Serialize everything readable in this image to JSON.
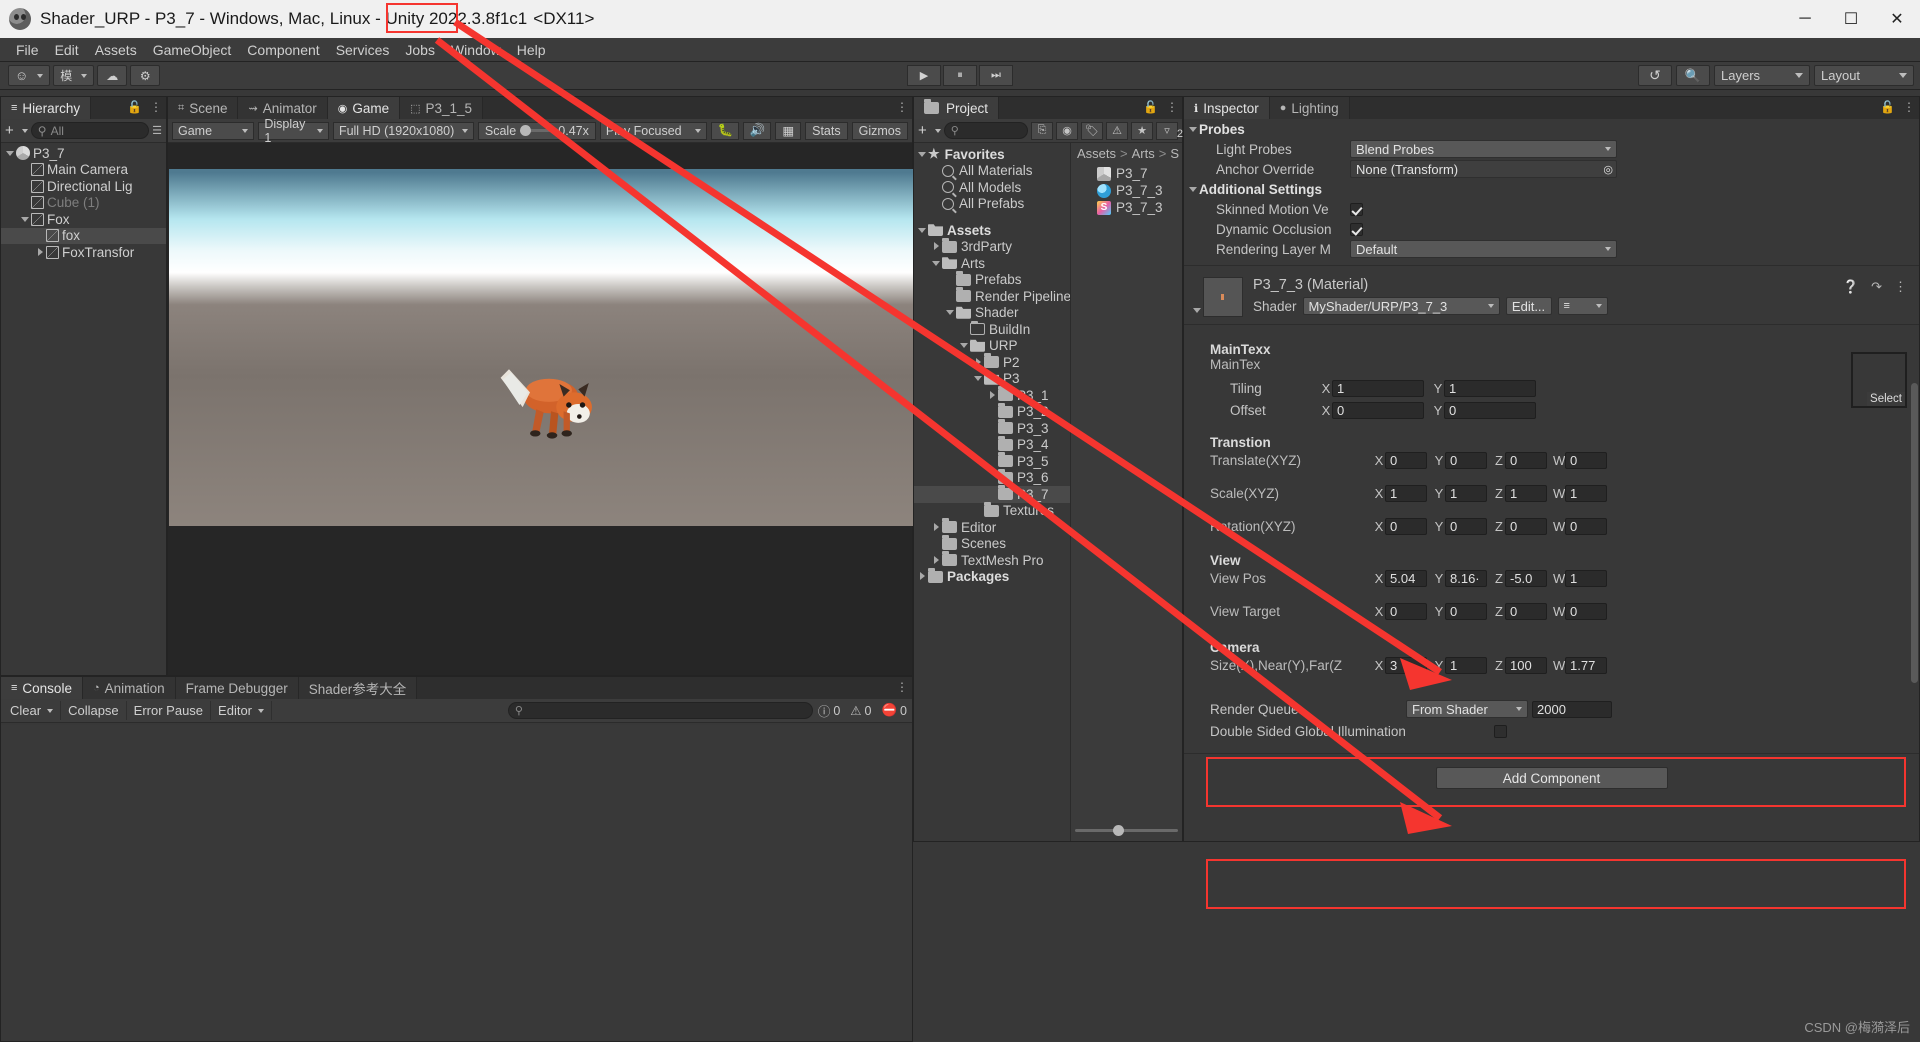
{
  "window": {
    "title": "Shader_URP - P3_7 - Windows, Mac, Linux - Unity 2022.3.8f1c1",
    "graphics_api": "<DX11>",
    "minimize": "─",
    "maximize": "☐",
    "close": "✕"
  },
  "menu": [
    "File",
    "Edit",
    "Assets",
    "GameObject",
    "Component",
    "Services",
    "Jobs",
    "Window",
    "Help"
  ],
  "toolbar": {
    "account_label": "☺",
    "cloud_label": "☁",
    "settings_label": "⚙",
    "collab_label": "模",
    "play": "▶",
    "pause": "⏸",
    "step": "⏭",
    "undo_history": "↺",
    "search": "search-icon",
    "layers": "Layers",
    "layout": "Layout"
  },
  "hierarchy": {
    "tab": "Hierarchy",
    "add_label": "+",
    "search_placeholder": "All",
    "items": [
      {
        "label": "P3_7",
        "indent": 0,
        "icon": "unity",
        "expand": "down",
        "dim": false,
        "selected": false
      },
      {
        "label": "Main Camera",
        "indent": 1,
        "icon": "cube",
        "expand": "none",
        "dim": false,
        "selected": false
      },
      {
        "label": "Directional Lig",
        "indent": 1,
        "icon": "cube",
        "expand": "none",
        "dim": false,
        "selected": false
      },
      {
        "label": "Cube (1)",
        "indent": 1,
        "icon": "cube",
        "expand": "none",
        "dim": true,
        "selected": false
      },
      {
        "label": "Fox",
        "indent": 1,
        "icon": "cube",
        "expand": "down",
        "dim": false,
        "selected": false
      },
      {
        "label": "fox",
        "indent": 2,
        "icon": "cube",
        "expand": "none",
        "dim": false,
        "selected": true
      },
      {
        "label": "FoxTransfor",
        "indent": 2,
        "icon": "cube",
        "expand": "right",
        "dim": false,
        "selected": false
      }
    ]
  },
  "gameview": {
    "tabs": [
      {
        "label": "Scene",
        "icon": "grid-icon",
        "active": false
      },
      {
        "label": "Animator",
        "icon": "animator-icon",
        "active": false
      },
      {
        "label": "Game",
        "icon": "gamepad-icon",
        "active": true
      },
      {
        "label": "P3_1_5",
        "icon": "shader-icon",
        "active": false
      }
    ],
    "mode": "Game",
    "display": "Display 1",
    "resolution": "Full HD (1920x1080)",
    "scale_label": "Scale",
    "scale_value": "0.47x",
    "play_mode": "Play Focused",
    "mute_icon": "mute-audio-icon",
    "bug_icon": "bug-icon",
    "stats": "Stats",
    "gizmos": "Gizmos"
  },
  "project": {
    "tab": "Project",
    "add_label": "+",
    "search_placeholder": "",
    "icons": [
      "save-search-icon",
      "object-filter-icon",
      "label-filter-icon",
      "warning-filter-icon",
      "favorite-filter-icon",
      "hidden-packages-icon"
    ],
    "hidden_count": "2",
    "tree": [
      {
        "label": "Favorites",
        "indent": 0,
        "expand": "down",
        "icon": "star",
        "bold": true
      },
      {
        "label": "All Materials",
        "indent": 1,
        "expand": "none",
        "icon": "search",
        "bold": false
      },
      {
        "label": "All Models",
        "indent": 1,
        "expand": "none",
        "icon": "search",
        "bold": false
      },
      {
        "label": "All Prefabs",
        "indent": 1,
        "expand": "none",
        "icon": "search",
        "bold": false
      },
      {
        "label": "",
        "indent": 0,
        "expand": "none",
        "icon": "none",
        "bold": false
      },
      {
        "label": "Assets",
        "indent": 0,
        "expand": "down",
        "icon": "folder-open",
        "bold": true
      },
      {
        "label": "3rdParty",
        "indent": 1,
        "expand": "right",
        "icon": "folder",
        "bold": false
      },
      {
        "label": "Arts",
        "indent": 1,
        "expand": "down",
        "icon": "folder-open",
        "bold": false
      },
      {
        "label": "Prefabs",
        "indent": 2,
        "expand": "none",
        "icon": "folder",
        "bold": false
      },
      {
        "label": "Render Pipeline",
        "indent": 2,
        "expand": "none",
        "icon": "folder",
        "bold": false
      },
      {
        "label": "Shader",
        "indent": 2,
        "expand": "down",
        "icon": "folder-open",
        "bold": false
      },
      {
        "label": "BuildIn",
        "indent": 3,
        "expand": "none",
        "icon": "folder-outline",
        "bold": false
      },
      {
        "label": "URP",
        "indent": 3,
        "expand": "down",
        "icon": "folder-open",
        "bold": false
      },
      {
        "label": "P2",
        "indent": 4,
        "expand": "right",
        "icon": "folder",
        "bold": false
      },
      {
        "label": "P3",
        "indent": 4,
        "expand": "down",
        "icon": "folder-open",
        "bold": false
      },
      {
        "label": "P3_1",
        "indent": 5,
        "expand": "right",
        "icon": "folder",
        "bold": false
      },
      {
        "label": "P3_2",
        "indent": 5,
        "expand": "none",
        "icon": "folder",
        "bold": false
      },
      {
        "label": "P3_3",
        "indent": 5,
        "expand": "none",
        "icon": "folder",
        "bold": false
      },
      {
        "label": "P3_4",
        "indent": 5,
        "expand": "none",
        "icon": "folder",
        "bold": false
      },
      {
        "label": "P3_5",
        "indent": 5,
        "expand": "none",
        "icon": "folder",
        "bold": false
      },
      {
        "label": "P3_6",
        "indent": 5,
        "expand": "none",
        "icon": "folder",
        "bold": false
      },
      {
        "label": "P3_7",
        "indent": 5,
        "expand": "none",
        "icon": "folder",
        "bold": false,
        "selected": true
      },
      {
        "label": "Textures",
        "indent": 4,
        "expand": "none",
        "icon": "folder",
        "bold": false
      },
      {
        "label": "Editor",
        "indent": 1,
        "expand": "right",
        "icon": "folder",
        "bold": false
      },
      {
        "label": "Scenes",
        "indent": 1,
        "expand": "none",
        "icon": "folder",
        "bold": false
      },
      {
        "label": "TextMesh Pro",
        "indent": 1,
        "expand": "right",
        "icon": "folder",
        "bold": false
      },
      {
        "label": "Packages",
        "indent": 0,
        "expand": "right",
        "icon": "folder",
        "bold": true
      }
    ],
    "breadcrumb": [
      "Assets",
      "Arts",
      "S"
    ],
    "assets": [
      {
        "label": "P3_7",
        "icon": "unity-scene-icon"
      },
      {
        "label": "P3_7_3",
        "icon": "material-icon"
      },
      {
        "label": "P3_7_3",
        "icon": "shader-icon"
      }
    ]
  },
  "inspector": {
    "tabs": [
      {
        "label": "Inspector",
        "icon": "info-icon",
        "active": true
      },
      {
        "label": "Lighting",
        "icon": "bulb-icon",
        "active": false
      }
    ],
    "probes": {
      "title": "Probes",
      "light_probes_label": "Light Probes",
      "light_probes_value": "Blend Probes",
      "anchor_label": "Anchor Override",
      "anchor_value": "None (Transform)"
    },
    "additional": {
      "title": "Additional Settings",
      "skinned_label": "Skinned Motion Ve",
      "skinned_checked": true,
      "dynamic_label": "Dynamic Occlusion",
      "dynamic_checked": true,
      "render_layer_label": "Rendering Layer M",
      "render_layer_value": "Default"
    },
    "material": {
      "title": "P3_7_3 (Material)",
      "shader_label": "Shader",
      "shader_value": "MyShader/URP/P3_7_3",
      "edit_button": "Edit...",
      "help_icon": "help-icon",
      "preset_icon": "preset-icon",
      "menu_icon": "kebab-menu-icon"
    },
    "maintex": {
      "title": "MainTexx",
      "subtitle": "MainTex",
      "tiling_label": "Tiling",
      "tiling_x": "1",
      "tiling_y": "1",
      "offset_label": "Offset",
      "offset_x": "0",
      "offset_y": "0",
      "select_label": "Select"
    },
    "transtion": {
      "title": "Transtion",
      "translate_label": "Translate(XYZ)",
      "translate": [
        "0",
        "0",
        "0",
        "0"
      ],
      "scale_label": "Scale(XYZ)",
      "scale": [
        "1",
        "1",
        "1",
        "1"
      ],
      "rotation_label": "Rotation(XYZ)",
      "rotation": [
        "0",
        "0",
        "0",
        "0"
      ]
    },
    "view": {
      "title": "View",
      "pos_label": "View Pos",
      "pos": [
        "5.04",
        "8.16·",
        "-5.0",
        "1"
      ],
      "target_label": "View Target",
      "target": [
        "0",
        "0",
        "0",
        "0"
      ]
    },
    "camera": {
      "title": "Camera",
      "params_label": "Size(X),Near(Y),Far(Z",
      "params": [
        "3",
        "1",
        "100",
        "1.77"
      ]
    },
    "render_queue": {
      "label": "Render Queue",
      "mode": "From Shader",
      "value": "2000"
    },
    "double_sided": {
      "label": "Double Sided Global Illumination",
      "checked": false
    },
    "add_component": "Add Component",
    "axis_labels": [
      "X",
      "Y",
      "Z",
      "W"
    ]
  },
  "console": {
    "tabs": [
      {
        "label": "Console",
        "icon": "console-icon",
        "active": true
      },
      {
        "label": "Animation",
        "icon": "clock-icon",
        "active": false
      },
      {
        "label": "Frame Debugger",
        "icon": "",
        "active": false
      },
      {
        "label": "Shader参考大全",
        "icon": "",
        "active": false
      }
    ],
    "clear": "Clear",
    "collapse": "Collapse",
    "error_pause": "Error Pause",
    "editor": "Editor",
    "search_placeholder": "",
    "counts": {
      "info": "0",
      "warning": "0",
      "error": "0"
    }
  },
  "watermark": "CSDN @梅漪泽后"
}
